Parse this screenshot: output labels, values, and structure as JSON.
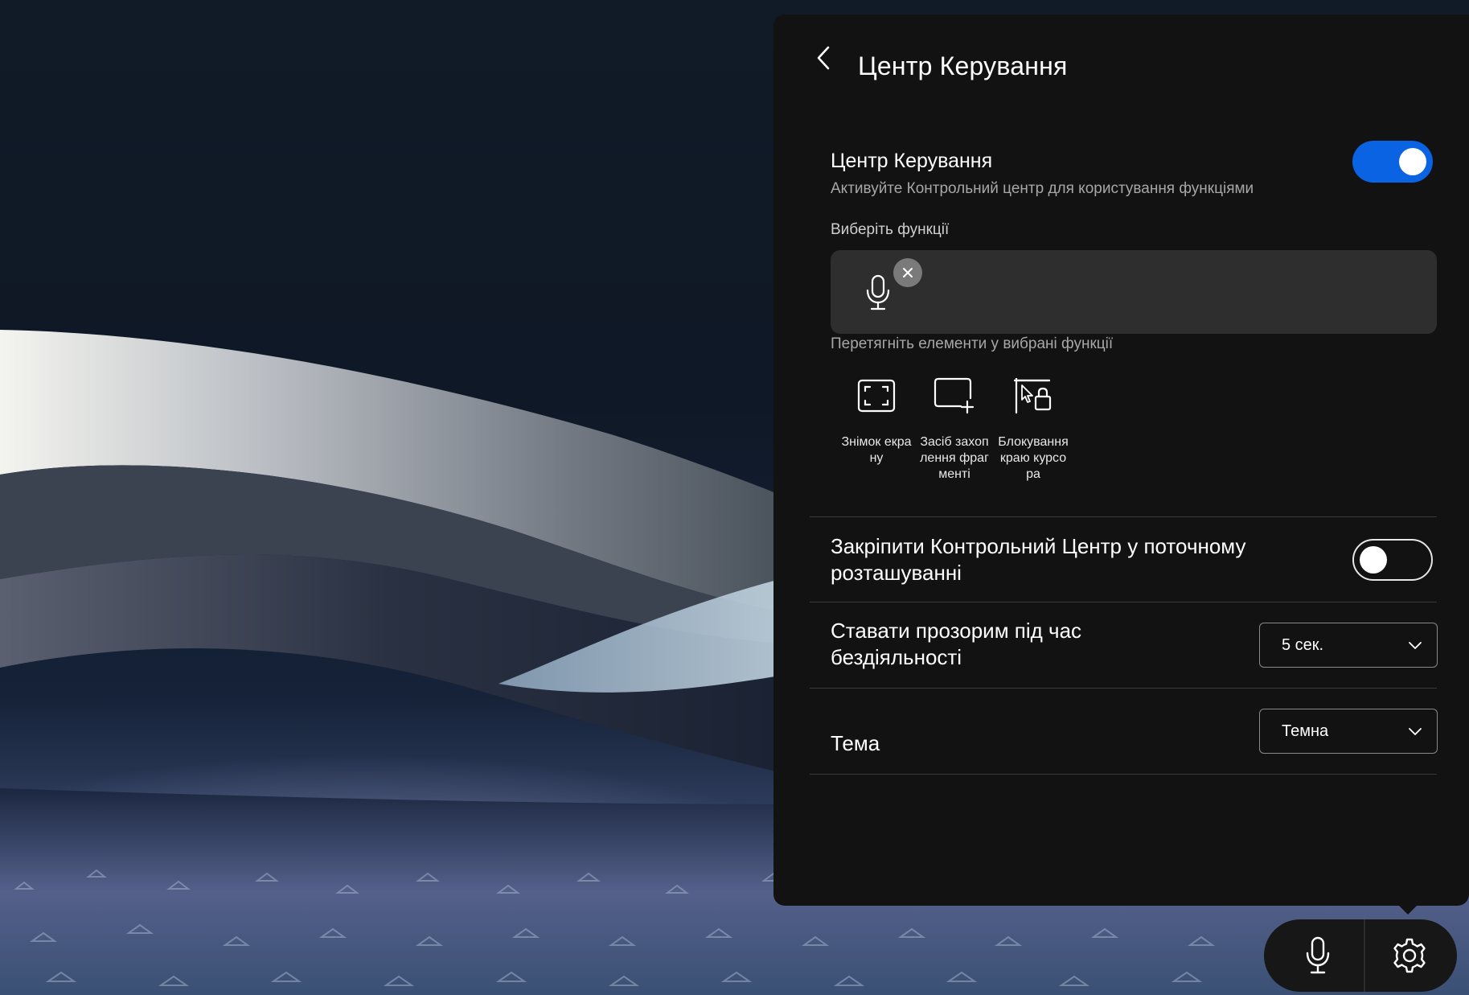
{
  "panel": {
    "title": "Центр Керування",
    "control_center": {
      "title": "Центр Керування",
      "subtitle": "Активуйте Контрольний центр для користування функціями",
      "enabled": true
    },
    "choose_label": "Виберіть функції",
    "selected_functions": [
      {
        "name": "microphone",
        "icon": "microphone-icon"
      }
    ],
    "drag_label": "Перетягніть елементи у вибрані функції",
    "available_functions": [
      {
        "label": "Знімок екрану",
        "icon": "screenshot-icon"
      },
      {
        "label": "Засіб захоплення фрагменті",
        "icon": "snipping-tool-icon"
      },
      {
        "label": "Блокування краю курсора",
        "icon": "cursor-edge-lock-icon"
      }
    ],
    "pin_setting": {
      "label": "Закріпити Контрольний Центр у поточному розташуванні",
      "enabled": false
    },
    "transparency_setting": {
      "label": "Ставати прозорим під час бездіяльності",
      "value": "5 сек."
    },
    "theme_setting": {
      "label": "Тема",
      "value": "Темна"
    }
  },
  "dock": {
    "buttons": [
      {
        "name": "microphone",
        "icon": "microphone-icon"
      },
      {
        "name": "settings",
        "icon": "gear-icon"
      }
    ]
  },
  "colors": {
    "accent": "#0a63e2",
    "panel_background": "#121212",
    "selected_box": "#2e2e2e"
  }
}
